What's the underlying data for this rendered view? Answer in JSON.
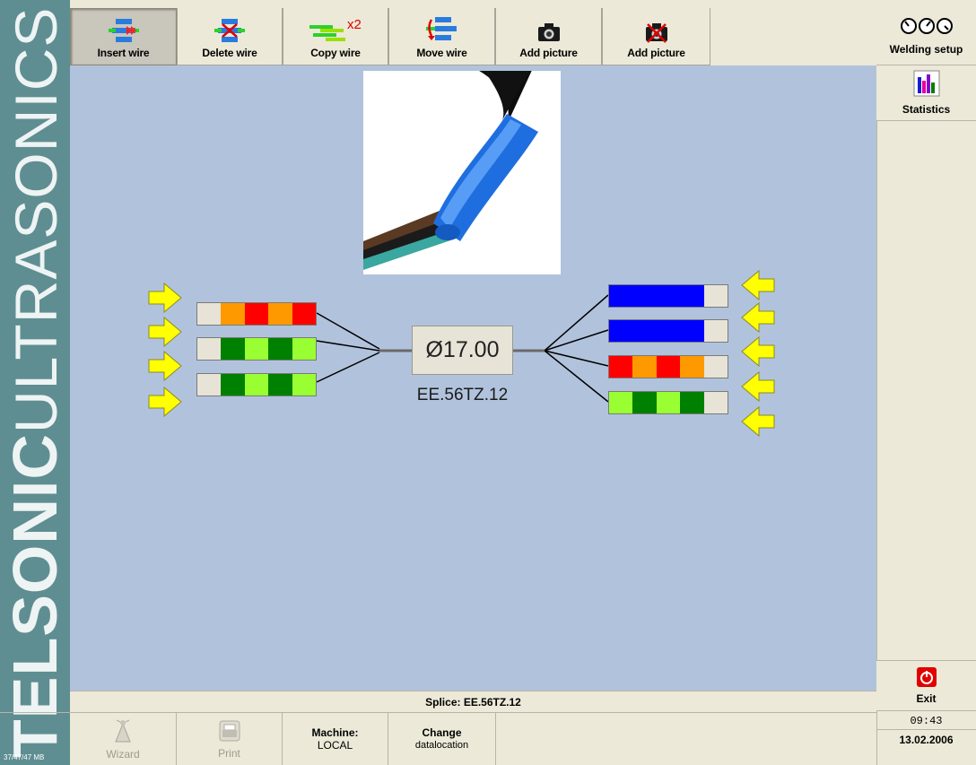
{
  "brand": {
    "bold": "TELSONIC",
    "light": "ULTRASONICS",
    "memory": "37/47/47 MB"
  },
  "toolbar": [
    {
      "id": "insert",
      "label": "Insert wire",
      "icon": "insert-wire-icon",
      "active": true
    },
    {
      "id": "delete",
      "label": "Delete wire",
      "icon": "delete-wire-icon",
      "active": false
    },
    {
      "id": "copy",
      "label": "Copy wire",
      "icon": "copy-wire-icon",
      "active": false
    },
    {
      "id": "move",
      "label": "Move wire",
      "icon": "move-wire-icon",
      "active": false
    },
    {
      "id": "add_picture",
      "label": "Add picture",
      "icon": "camera-icon",
      "active": false
    },
    {
      "id": "remove_picture",
      "label": "Add picture",
      "icon": "camera-remove-icon",
      "active": false
    }
  ],
  "copy_badge": "x2",
  "right_panel": {
    "welding_setup": "Welding setup",
    "statistics": "Statistics",
    "exit": "Exit",
    "time": "09:43",
    "date": "13.02.2006"
  },
  "splice": {
    "diameter": "Ø17.00",
    "id": "EE.56TZ.12",
    "left_wires": [
      {
        "colors": [
          "#e7e3d6",
          "#ff9900",
          "#ff0000",
          "#ff9900",
          "#ff0000"
        ]
      },
      {
        "colors": [
          "#e7e3d6",
          "#008000",
          "#99ff33",
          "#008000",
          "#99ff33"
        ]
      },
      {
        "colors": [
          "#e7e3d6",
          "#008000",
          "#99ff33",
          "#008000",
          "#99ff33"
        ]
      }
    ],
    "right_wires": [
      {
        "colors": [
          "#0000ff",
          "#0000ff",
          "#0000ff",
          "#0000ff",
          "#e7e3d6"
        ]
      },
      {
        "colors": [
          "#0000ff",
          "#0000ff",
          "#0000ff",
          "#0000ff",
          "#e7e3d6"
        ]
      },
      {
        "colors": [
          "#ff0000",
          "#ff9900",
          "#ff0000",
          "#ff9900",
          "#e7e3d6"
        ]
      },
      {
        "colors": [
          "#99ff33",
          "#008000",
          "#99ff33",
          "#008000",
          "#e7e3d6"
        ]
      }
    ],
    "left_arrow_count": 4,
    "right_arrow_count": 5
  },
  "status": {
    "splice_label": "Splice: EE.56TZ.12"
  },
  "bottom": {
    "wizard": "Wizard",
    "print": "Print",
    "machine_label": "Machine:",
    "machine_value": "LOCAL",
    "change_line1": "Change",
    "change_line2": "datalocation"
  },
  "colors": {
    "canvas": "#b1c3dc",
    "brand": "#5e8e91",
    "arrow": "#ffff00"
  }
}
